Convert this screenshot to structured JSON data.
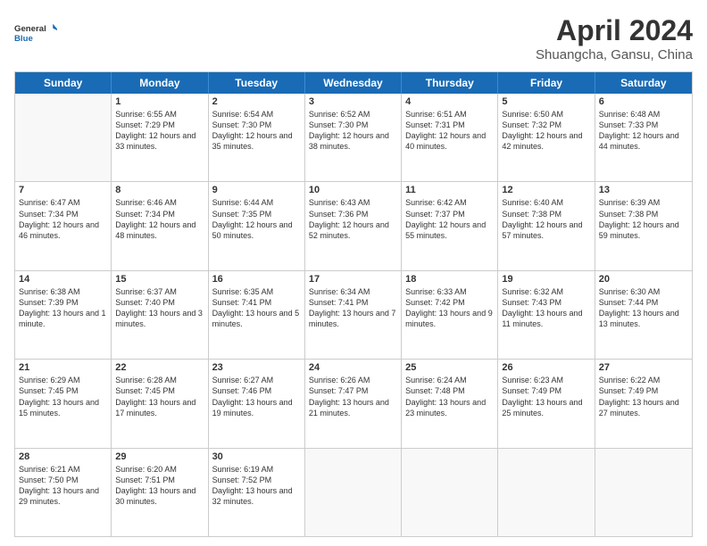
{
  "logo": {
    "line1": "General",
    "line2": "Blue"
  },
  "title": "April 2024",
  "subtitle": "Shuangcha, Gansu, China",
  "header_days": [
    "Sunday",
    "Monday",
    "Tuesday",
    "Wednesday",
    "Thursday",
    "Friday",
    "Saturday"
  ],
  "weeks": [
    [
      {
        "day": "",
        "sunrise": "",
        "sunset": "",
        "daylight": ""
      },
      {
        "day": "1",
        "sunrise": "Sunrise: 6:55 AM",
        "sunset": "Sunset: 7:29 PM",
        "daylight": "Daylight: 12 hours and 33 minutes."
      },
      {
        "day": "2",
        "sunrise": "Sunrise: 6:54 AM",
        "sunset": "Sunset: 7:30 PM",
        "daylight": "Daylight: 12 hours and 35 minutes."
      },
      {
        "day": "3",
        "sunrise": "Sunrise: 6:52 AM",
        "sunset": "Sunset: 7:30 PM",
        "daylight": "Daylight: 12 hours and 38 minutes."
      },
      {
        "day": "4",
        "sunrise": "Sunrise: 6:51 AM",
        "sunset": "Sunset: 7:31 PM",
        "daylight": "Daylight: 12 hours and 40 minutes."
      },
      {
        "day": "5",
        "sunrise": "Sunrise: 6:50 AM",
        "sunset": "Sunset: 7:32 PM",
        "daylight": "Daylight: 12 hours and 42 minutes."
      },
      {
        "day": "6",
        "sunrise": "Sunrise: 6:48 AM",
        "sunset": "Sunset: 7:33 PM",
        "daylight": "Daylight: 12 hours and 44 minutes."
      }
    ],
    [
      {
        "day": "7",
        "sunrise": "Sunrise: 6:47 AM",
        "sunset": "Sunset: 7:34 PM",
        "daylight": "Daylight: 12 hours and 46 minutes."
      },
      {
        "day": "8",
        "sunrise": "Sunrise: 6:46 AM",
        "sunset": "Sunset: 7:34 PM",
        "daylight": "Daylight: 12 hours and 48 minutes."
      },
      {
        "day": "9",
        "sunrise": "Sunrise: 6:44 AM",
        "sunset": "Sunset: 7:35 PM",
        "daylight": "Daylight: 12 hours and 50 minutes."
      },
      {
        "day": "10",
        "sunrise": "Sunrise: 6:43 AM",
        "sunset": "Sunset: 7:36 PM",
        "daylight": "Daylight: 12 hours and 52 minutes."
      },
      {
        "day": "11",
        "sunrise": "Sunrise: 6:42 AM",
        "sunset": "Sunset: 7:37 PM",
        "daylight": "Daylight: 12 hours and 55 minutes."
      },
      {
        "day": "12",
        "sunrise": "Sunrise: 6:40 AM",
        "sunset": "Sunset: 7:38 PM",
        "daylight": "Daylight: 12 hours and 57 minutes."
      },
      {
        "day": "13",
        "sunrise": "Sunrise: 6:39 AM",
        "sunset": "Sunset: 7:38 PM",
        "daylight": "Daylight: 12 hours and 59 minutes."
      }
    ],
    [
      {
        "day": "14",
        "sunrise": "Sunrise: 6:38 AM",
        "sunset": "Sunset: 7:39 PM",
        "daylight": "Daylight: 13 hours and 1 minute."
      },
      {
        "day": "15",
        "sunrise": "Sunrise: 6:37 AM",
        "sunset": "Sunset: 7:40 PM",
        "daylight": "Daylight: 13 hours and 3 minutes."
      },
      {
        "day": "16",
        "sunrise": "Sunrise: 6:35 AM",
        "sunset": "Sunset: 7:41 PM",
        "daylight": "Daylight: 13 hours and 5 minutes."
      },
      {
        "day": "17",
        "sunrise": "Sunrise: 6:34 AM",
        "sunset": "Sunset: 7:41 PM",
        "daylight": "Daylight: 13 hours and 7 minutes."
      },
      {
        "day": "18",
        "sunrise": "Sunrise: 6:33 AM",
        "sunset": "Sunset: 7:42 PM",
        "daylight": "Daylight: 13 hours and 9 minutes."
      },
      {
        "day": "19",
        "sunrise": "Sunrise: 6:32 AM",
        "sunset": "Sunset: 7:43 PM",
        "daylight": "Daylight: 13 hours and 11 minutes."
      },
      {
        "day": "20",
        "sunrise": "Sunrise: 6:30 AM",
        "sunset": "Sunset: 7:44 PM",
        "daylight": "Daylight: 13 hours and 13 minutes."
      }
    ],
    [
      {
        "day": "21",
        "sunrise": "Sunrise: 6:29 AM",
        "sunset": "Sunset: 7:45 PM",
        "daylight": "Daylight: 13 hours and 15 minutes."
      },
      {
        "day": "22",
        "sunrise": "Sunrise: 6:28 AM",
        "sunset": "Sunset: 7:45 PM",
        "daylight": "Daylight: 13 hours and 17 minutes."
      },
      {
        "day": "23",
        "sunrise": "Sunrise: 6:27 AM",
        "sunset": "Sunset: 7:46 PM",
        "daylight": "Daylight: 13 hours and 19 minutes."
      },
      {
        "day": "24",
        "sunrise": "Sunrise: 6:26 AM",
        "sunset": "Sunset: 7:47 PM",
        "daylight": "Daylight: 13 hours and 21 minutes."
      },
      {
        "day": "25",
        "sunrise": "Sunrise: 6:24 AM",
        "sunset": "Sunset: 7:48 PM",
        "daylight": "Daylight: 13 hours and 23 minutes."
      },
      {
        "day": "26",
        "sunrise": "Sunrise: 6:23 AM",
        "sunset": "Sunset: 7:49 PM",
        "daylight": "Daylight: 13 hours and 25 minutes."
      },
      {
        "day": "27",
        "sunrise": "Sunrise: 6:22 AM",
        "sunset": "Sunset: 7:49 PM",
        "daylight": "Daylight: 13 hours and 27 minutes."
      }
    ],
    [
      {
        "day": "28",
        "sunrise": "Sunrise: 6:21 AM",
        "sunset": "Sunset: 7:50 PM",
        "daylight": "Daylight: 13 hours and 29 minutes."
      },
      {
        "day": "29",
        "sunrise": "Sunrise: 6:20 AM",
        "sunset": "Sunset: 7:51 PM",
        "daylight": "Daylight: 13 hours and 30 minutes."
      },
      {
        "day": "30",
        "sunrise": "Sunrise: 6:19 AM",
        "sunset": "Sunset: 7:52 PM",
        "daylight": "Daylight: 13 hours and 32 minutes."
      },
      {
        "day": "",
        "sunrise": "",
        "sunset": "",
        "daylight": ""
      },
      {
        "day": "",
        "sunrise": "",
        "sunset": "",
        "daylight": ""
      },
      {
        "day": "",
        "sunrise": "",
        "sunset": "",
        "daylight": ""
      },
      {
        "day": "",
        "sunrise": "",
        "sunset": "",
        "daylight": ""
      }
    ]
  ]
}
